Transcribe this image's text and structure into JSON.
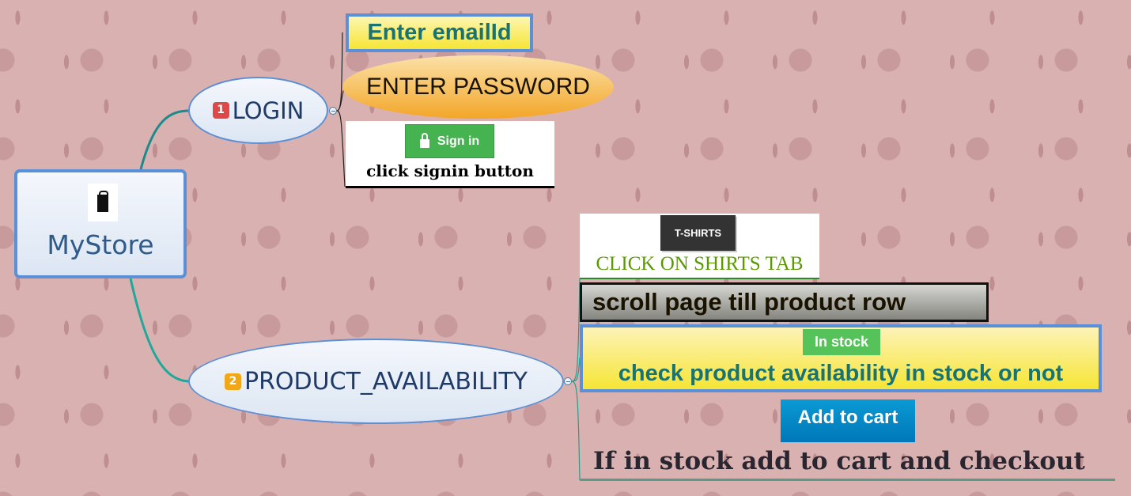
{
  "root": {
    "title": "MyStore",
    "icon": "shopping-bag-icon"
  },
  "branches": [
    {
      "badge": "1",
      "badge_color": "#e04848",
      "label": "LOGIN",
      "children": {
        "email": "Enter emailId",
        "password": "ENTER PASSWORD",
        "signin_button": "Sign in",
        "signin_text": "click signin button"
      }
    },
    {
      "badge": "2",
      "badge_color": "#f0a818",
      "label": "PRODUCT_AVAILABILITY",
      "children": {
        "tshirts_button": "T-SHIRTS",
        "tshirts_text": "CLICK ON SHIRTS TAB",
        "scroll_text": "scroll page till product row",
        "in_stock_badge": "In stock",
        "availability_text": "check product availability in stock or not",
        "add_to_cart_button": "Add to cart",
        "final_text": "If in stock add to cart and checkout"
      }
    }
  ]
}
